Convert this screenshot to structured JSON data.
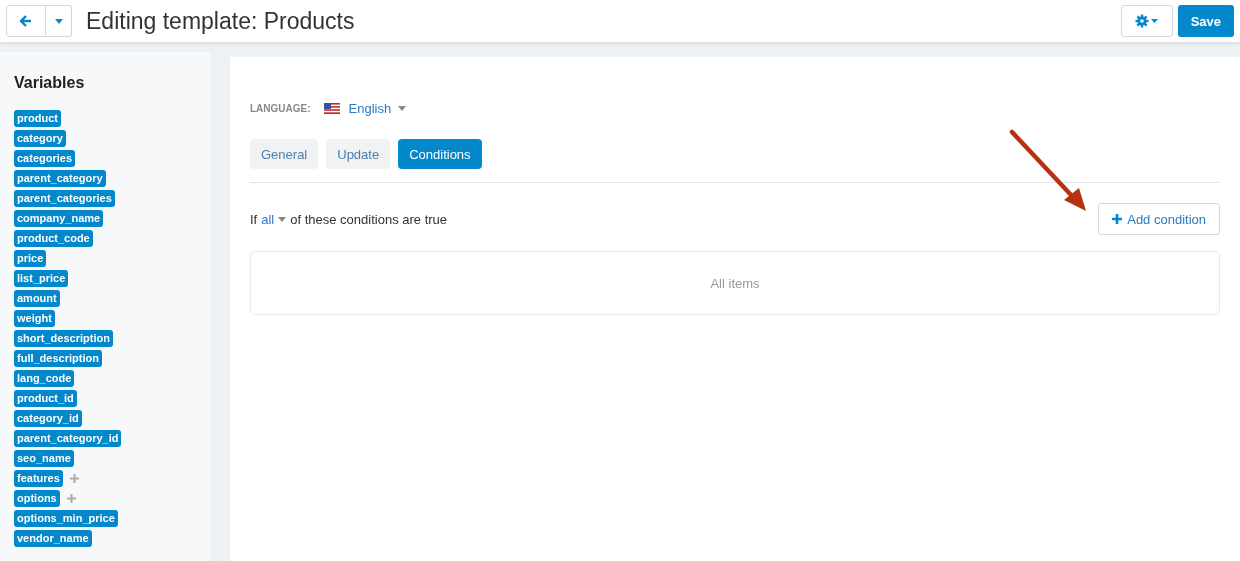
{
  "header": {
    "title": "Editing template: Products",
    "save_button": "Save"
  },
  "sidebar": {
    "title": "Variables",
    "variables": [
      {
        "name": "product",
        "expandable": false
      },
      {
        "name": "category",
        "expandable": false
      },
      {
        "name": "categories",
        "expandable": false
      },
      {
        "name": "parent_category",
        "expandable": false
      },
      {
        "name": "parent_categories",
        "expandable": false
      },
      {
        "name": "company_name",
        "expandable": false
      },
      {
        "name": "product_code",
        "expandable": false
      },
      {
        "name": "price",
        "expandable": false
      },
      {
        "name": "list_price",
        "expandable": false
      },
      {
        "name": "amount",
        "expandable": false
      },
      {
        "name": "weight",
        "expandable": false
      },
      {
        "name": "short_description",
        "expandable": false
      },
      {
        "name": "full_description",
        "expandable": false
      },
      {
        "name": "lang_code",
        "expandable": false
      },
      {
        "name": "product_id",
        "expandable": false
      },
      {
        "name": "category_id",
        "expandable": false
      },
      {
        "name": "parent_category_id",
        "expandable": false
      },
      {
        "name": "seo_name",
        "expandable": false
      },
      {
        "name": "features",
        "expandable": true
      },
      {
        "name": "options",
        "expandable": true
      },
      {
        "name": "options_min_price",
        "expandable": false
      },
      {
        "name": "vendor_name",
        "expandable": false
      }
    ]
  },
  "language": {
    "label": "LANGUAGE:",
    "value": "English"
  },
  "tabs": [
    {
      "label": "General",
      "selected": false
    },
    {
      "label": "Update",
      "selected": false
    },
    {
      "label": "Conditions",
      "selected": true
    }
  ],
  "conditions": {
    "prefix": "If",
    "selector": "all",
    "suffix": "of these conditions are true",
    "add_button": "Add condition",
    "empty_text": "All items"
  }
}
